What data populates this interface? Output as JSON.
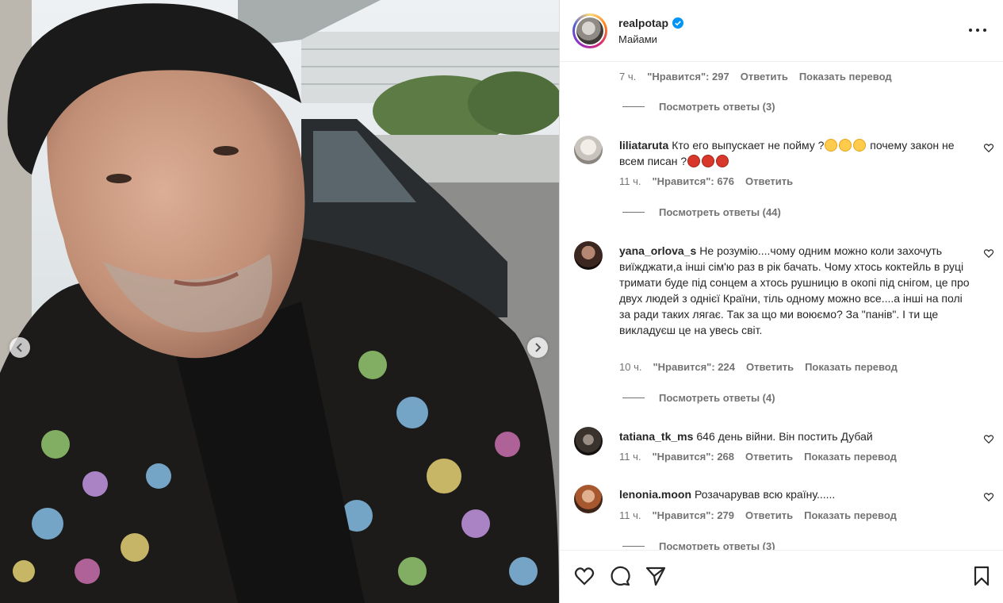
{
  "post": {
    "username": "realpotap",
    "location": "Майами",
    "verified_icon": "verified-badge-icon"
  },
  "colors": {
    "verified": "#0095f6",
    "text": "#262626",
    "muted": "#737373",
    "border": "#dbdbdb"
  },
  "comments": {
    "top_meta": {
      "time": "7 ч.",
      "likes": "\"Нравится\": 297",
      "reply": "Ответить",
      "translate": "Показать перевод"
    },
    "top_replies": "Посмотреть ответы (3)",
    "items": [
      {
        "username": "liliataruta",
        "text_a": "Кто его выпускает не пойму ?",
        "text_b": " почему закон не всем писан ?",
        "time": "11 ч.",
        "likes": "\"Нравится\": 676",
        "reply": "Ответить",
        "replies": "Посмотреть ответы (44)"
      },
      {
        "username": "yana_orlova_s",
        "text": "Не розумію....чому одним можно коли захочуть виїжджати,а інші сім'ю раз в рік бачать. Чому хтось коктейль в руці тримати буде під сонцем а хтось рушницю в окопі під снігом, це про двух людей з однієї Країни, тіль одному можно все....а інші на полі за ради таких лягає. Так за що ми воюємо? За \"панів\". І ти ще викладуєш це на увесь світ.",
        "time": "10 ч.",
        "likes": "\"Нравится\": 224",
        "reply": "Ответить",
        "translate": "Показать перевод",
        "replies": "Посмотреть ответы (4)"
      },
      {
        "username": "tatiana_tk_ms",
        "text": "646 день війни. Він постить Дубай",
        "time": "11 ч.",
        "likes": "\"Нравится\": 268",
        "reply": "Ответить",
        "translate": "Показать перевод"
      },
      {
        "username": "lenonia.moon",
        "text": "Розачарував всю країну......",
        "time": "11 ч.",
        "likes": "\"Нравится\": 279",
        "reply": "Ответить",
        "translate": "Показать перевод",
        "replies": "Посмотреть ответы (3)"
      }
    ]
  },
  "actions": [
    "heart-icon",
    "comment-icon",
    "share-icon",
    "save-icon"
  ]
}
